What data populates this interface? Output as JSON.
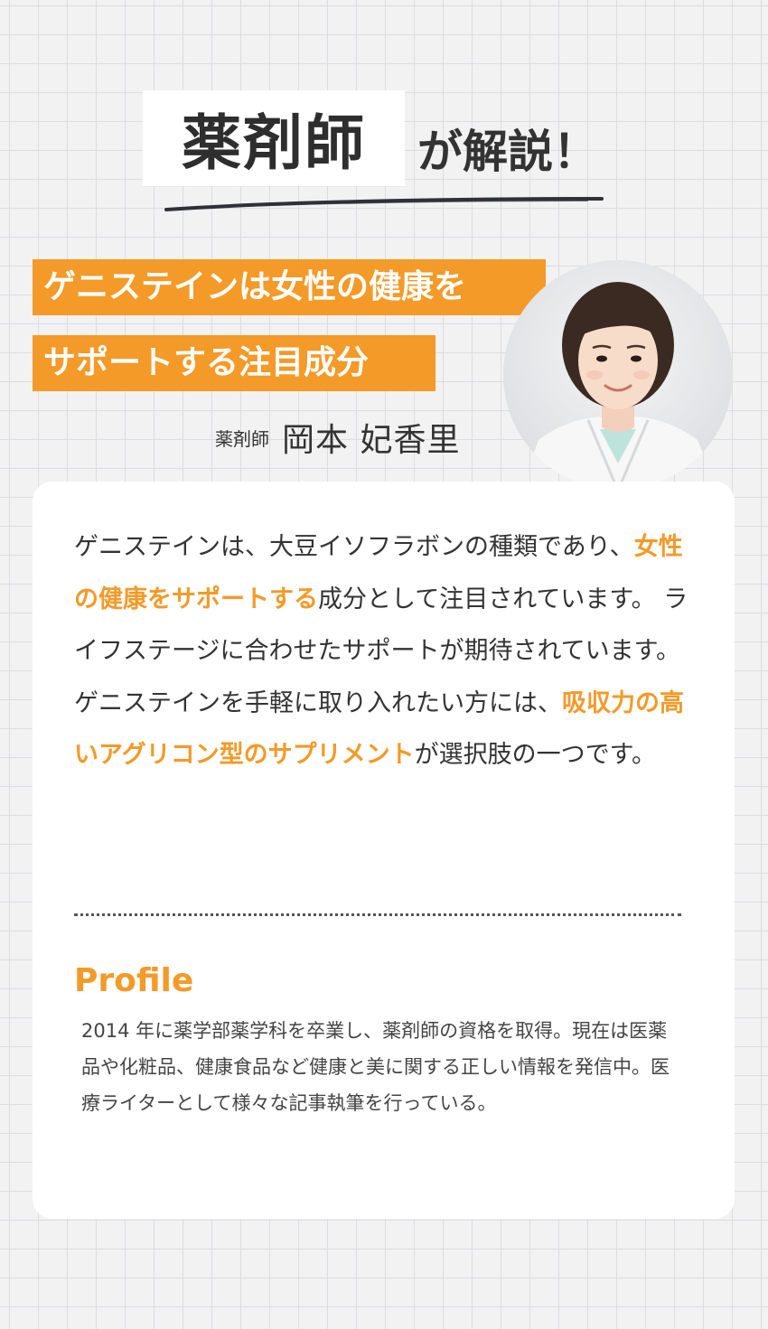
{
  "heading": {
    "strong": "薬剤師",
    "rest": "が解説！"
  },
  "title_lines": [
    "ゲニステインは女性の健康を",
    "サポートする注目成分"
  ],
  "person": {
    "role": "薬剤師",
    "name": "岡本 妃香里"
  },
  "body": {
    "p1a": "ゲニステインは、大豆イソフラボンの種類であり、",
    "p1_highlight": "女性の健康をサポートする",
    "p1b": "成分として注目されています。 ライフステージに合わせたサポートが期待されています。",
    "p2a": "ゲニステインを手軽に取り入れたい方には、",
    "p2_highlight": "吸収力の高いアグリコン型のサプリメント",
    "p2b": "が選択肢の一つです。"
  },
  "profile": {
    "title": "Profile",
    "text": "2014 年に薬学部薬学科を卒業し、薬剤師の資格を取得。現在は医薬品や化粧品、健康食品など健康と美に関する正しい情報を発信中。医療ライターとして様々な記事執筆を行っている。"
  },
  "colors": {
    "accent": "#f39a28",
    "text": "#333333",
    "grid": "#dcdde2",
    "background": "#f2f2f2"
  }
}
